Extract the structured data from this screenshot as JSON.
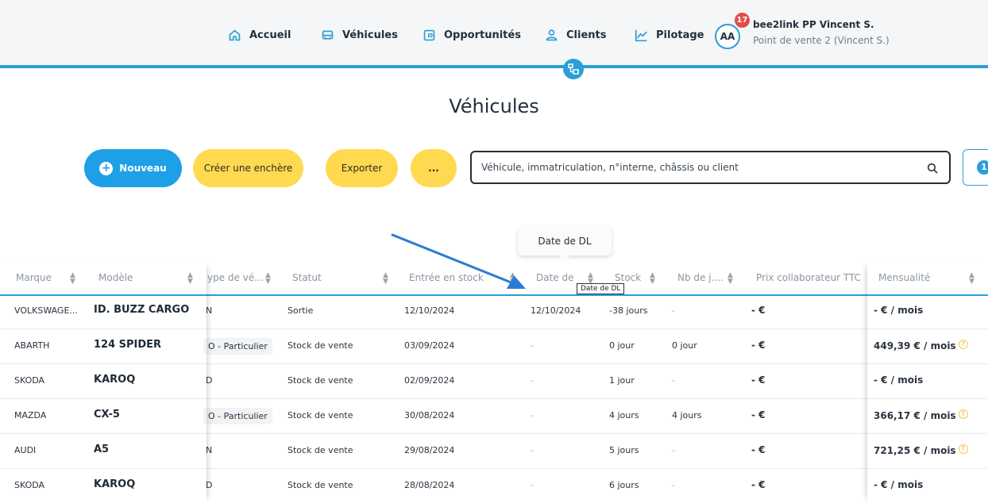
{
  "nav": {
    "items": [
      {
        "label": "Accueil",
        "icon": "home-icon"
      },
      {
        "label": "Véhicules",
        "icon": "car-icon"
      },
      {
        "label": "Opportunités",
        "icon": "wallet-icon"
      },
      {
        "label": "Clients",
        "icon": "user-icon"
      },
      {
        "label": "Pilotage",
        "icon": "chart-icon"
      }
    ],
    "avatar_initials": "AA",
    "notification_count": "17",
    "user_name": "bee2link PP Vincent S.",
    "user_location": "Point de vente 2 (Vincent S.)"
  },
  "page": {
    "title": "Véhicules"
  },
  "actions": {
    "new_label": "Nouveau",
    "auction_label": "Créer une enchère",
    "export_label": "Exporter",
    "more_label": "..."
  },
  "search": {
    "placeholder": "Véhicule, immatriculation, n°interne, châssis ou client"
  },
  "filter": {
    "count": "1"
  },
  "tooltips": {
    "big": "Date de DL",
    "small": "Date de DL"
  },
  "table": {
    "headers": {
      "marque": "Marque",
      "modele": "Modèle",
      "type": "ype de vé...",
      "statut": "Statut",
      "entree": "Entrée en stock",
      "date_dl": "Date de",
      "stock": "Stock",
      "nb_jours": "Nb de j....",
      "prix": "Prix collaborateur TTC",
      "mensualite": "Mensualité"
    },
    "rows": [
      {
        "marque": "VOLKSWAGE...",
        "modele": "ID. BUZZ CARGO",
        "type": "N",
        "statut": "Sortie",
        "entree": "12/10/2024",
        "date_dl": "12/10/2024",
        "stock": "-38 jours",
        "nb_jours": "-",
        "prix": "- €",
        "mensualite": "- € / mois"
      },
      {
        "marque": "ABARTH",
        "modele": "124 SPIDER",
        "type": "O - Particulier",
        "statut": "Stock de vente",
        "entree": "03/09/2024",
        "date_dl": "-",
        "stock": "0 jour",
        "nb_jours": "0 jour",
        "prix": "- €",
        "mensualite": "449,39 € / mois"
      },
      {
        "marque": "SKODA",
        "modele": "KAROQ",
        "type": "D",
        "statut": "Stock de vente",
        "entree": "02/09/2024",
        "date_dl": "-",
        "stock": "1 jour",
        "nb_jours": "-",
        "prix": "- €",
        "mensualite": "- € / mois"
      },
      {
        "marque": "MAZDA",
        "modele": "CX-5",
        "type": "O - Particulier",
        "statut": "Stock de vente",
        "entree": "30/08/2024",
        "date_dl": "-",
        "stock": "4 jours",
        "nb_jours": "4 jours",
        "prix": "- €",
        "mensualite": "366,17 € / mois"
      },
      {
        "marque": "AUDI",
        "modele": "A5",
        "type": "N",
        "statut": "Stock de vente",
        "entree": "29/08/2024",
        "date_dl": "-",
        "stock": "5 jours",
        "nb_jours": "-",
        "prix": "- €",
        "mensualite": "721,25 € / mois"
      },
      {
        "marque": "SKODA",
        "modele": "KAROQ",
        "type": "D",
        "statut": "Stock de vente",
        "entree": "28/08/2024",
        "date_dl": "-",
        "stock": "6 jours",
        "nb_jours": "-",
        "prix": "- €",
        "mensualite": "- € / mois"
      }
    ]
  },
  "colors": {
    "accent": "#2a9fd8",
    "primary_button": "#1ea0e6",
    "secondary_button": "#ffd950",
    "annotation_arrow": "#2b7cd3"
  }
}
